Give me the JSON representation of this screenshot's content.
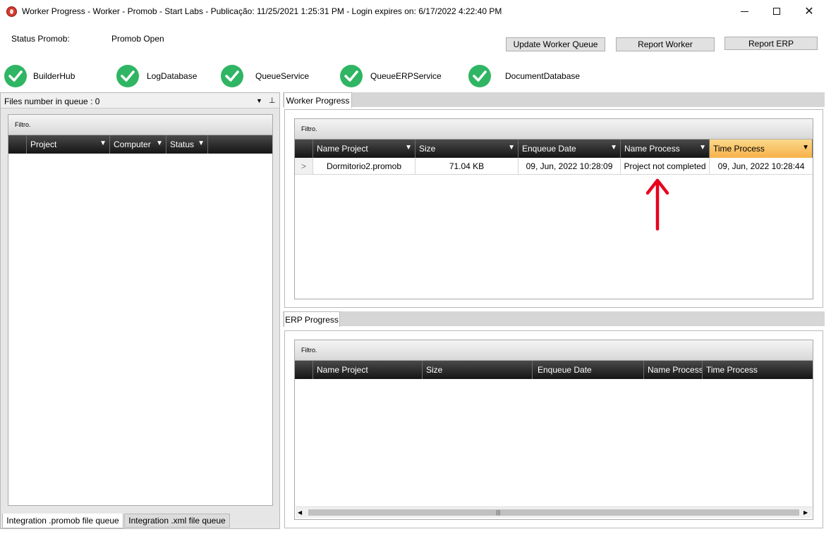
{
  "window": {
    "title": "Worker Progress  -  Worker  - Promob  -  Start Labs  -  Publicação: 11/25/2021 1:25:31 PM - Login expires on: 6/17/2022 4:22:40 PM",
    "minimize": "",
    "close": "✕"
  },
  "status": {
    "label": "Status Promob:",
    "value": "Promob Open"
  },
  "toolbar": {
    "update_label": "Update Worker Queue",
    "report_worker_label": "Report Worker",
    "report_erp_label": "Report ERP"
  },
  "services": [
    {
      "name": "BuilderHub",
      "status": "ok",
      "icon": "check-circle-icon"
    },
    {
      "name": "LogDatabase",
      "status": "ok",
      "icon": "check-circle-icon"
    },
    {
      "name": "QueueService",
      "status": "ok",
      "icon": "check-circle-icon"
    },
    {
      "name": "QueueERPService",
      "status": "ok",
      "icon": "check-circle-icon"
    },
    {
      "name": "DocumentDatabase",
      "status": "ok",
      "icon": "check-circle-icon"
    }
  ],
  "left_panel": {
    "header": "Files number in queue : 0",
    "dropdown_icon": "▼",
    "pin_icon": "⊥",
    "filter_label": "Filtro.",
    "columns": [
      "Project",
      "Computer",
      "Status"
    ],
    "tabs": [
      "Integration .promob file queue",
      "Integration .xml file queue"
    ]
  },
  "worker_progress": {
    "tab": "Worker Progress",
    "filter_label": "Filtro.",
    "columns": [
      "Name Project",
      "Size",
      "Enqueue Date",
      "Name Process",
      "Time Process"
    ],
    "rows": [
      {
        "indicator": ">",
        "name_project": "Dormitorio2.promob",
        "size": "71.04 KB",
        "enqueue_date": "09, Jun, 2022 10:28:09",
        "name_process": "Project not completed",
        "time_process": "09, Jun, 2022 10:28:44"
      }
    ]
  },
  "erp_progress": {
    "tab": "ERP Progress",
    "filter_label": "Filtro.",
    "columns": [
      "Name Project",
      "Size",
      "Enqueue Date",
      "Name Process",
      "Time Process"
    ],
    "scroll_left": "◀",
    "scroll_right": "▶",
    "scroll_grip": "|||"
  },
  "colors": {
    "accent_check": "#2fb563",
    "sorted_header": "#f7b14a",
    "annotation_arrow": "#e8001c",
    "grid_header": "#151515"
  }
}
